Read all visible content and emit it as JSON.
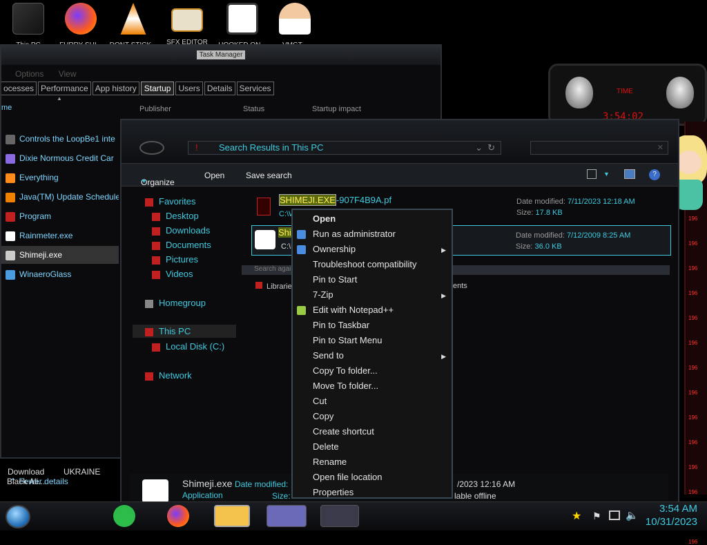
{
  "desktop_icons": [
    {
      "label": "This PC",
      "icon": "pc-icon"
    },
    {
      "label": "FURRY SHI...",
      "icon": "firefox-icon"
    },
    {
      "label": "DONT STICK...",
      "icon": "vlc-icon"
    },
    {
      "label": "SFX EDITOR",
      "icon": "hxd-icon"
    },
    {
      "label": "HOOKED ON...",
      "icon": "app-icon"
    },
    {
      "label": "VMGT...",
      "icon": "doctor-icon"
    }
  ],
  "task_manager": {
    "title": "Task Manager",
    "menu": [
      "Options",
      "View"
    ],
    "tabs": [
      "ocesses",
      "Performance",
      "App history",
      "Startup",
      "Users",
      "Details",
      "Services"
    ],
    "active_tab": "Startup",
    "columns": [
      "me",
      "Publisher",
      "Status",
      "Startup impact"
    ],
    "rows": [
      "Controls the LoopBe1 inte",
      "Dixie Normous Credit Car",
      "Everything",
      "Java(TM) Update Schedule",
      "Program",
      "Rainmeter.exe",
      "Shimeji.exe",
      "WinaeroGlass"
    ],
    "selected_row": "Shimeji.exe",
    "fewer_details": "Fewer details"
  },
  "desktop_bottom": {
    "item1_line1": "Download",
    "item1_line2": "Black Ali...",
    "item2": "UKRAINE"
  },
  "explorer": {
    "address": "Search Results in This PC",
    "toolbar": {
      "organize": "Organize",
      "open": "Open",
      "save_search": "Save search"
    },
    "nav": {
      "favorites": "Favorites",
      "desktop": "Desktop",
      "downloads": "Downloads",
      "documents": "Documents",
      "pictures": "Pictures",
      "videos": "Videos",
      "homegroup": "Homegroup",
      "this_pc": "This PC",
      "local_disk": "Local Disk (C:)",
      "network": "Network"
    },
    "files": [
      {
        "name_highlight": "SHIMEJI.EXE",
        "name_rest": "-907F4B9A.pf",
        "path": "C:\\W",
        "date_label": "Date modified:",
        "date": "7/11/2023 12:18 AM",
        "size_label": "Size:",
        "size": "17.8 KB"
      },
      {
        "name_highlight": "Shi",
        "name_rest": "",
        "path": "C:\\P",
        "date_label": "Date modified:",
        "date": "7/12/2009 8:25 AM",
        "size_label": "Size:",
        "size": "36.0 KB"
      }
    ],
    "search_again": "Search again in:",
    "libraries": "Librarie",
    "contents": "ents",
    "status": {
      "name": "Shimeji.exe",
      "type": "Application",
      "date_label": "Date modified:",
      "date": "/2023 12:16 AM",
      "size_label": "Size:",
      "availability": "lable offline"
    }
  },
  "context_menu": [
    {
      "label": "Open",
      "bold": true
    },
    {
      "label": "Run as administrator",
      "icon": "shield-icon"
    },
    {
      "label": "Ownership",
      "submenu": true,
      "icon": "ownership-icon"
    },
    {
      "label": "Troubleshoot compatibility"
    },
    {
      "label": "Pin to Start"
    },
    {
      "label": "7-Zip",
      "submenu": true
    },
    {
      "label": "Edit with Notepad++",
      "icon": "notepad-icon"
    },
    {
      "label": "Pin to Taskbar"
    },
    {
      "label": "Pin to Start Menu"
    },
    {
      "label": "Send to",
      "submenu": true
    },
    {
      "label": "Copy To folder..."
    },
    {
      "label": "Move To folder..."
    },
    {
      "label": "Cut"
    },
    {
      "label": "Copy"
    },
    {
      "label": "Create shortcut"
    },
    {
      "label": "Delete"
    },
    {
      "label": "Rename"
    },
    {
      "label": "Open file location"
    },
    {
      "label": "Properties"
    }
  ],
  "widget": {
    "label": "TIME",
    "time": "3:54:02"
  },
  "red_side_text": [
    "196",
    "196",
    "196",
    "196",
    "196",
    "196",
    "196",
    "196",
    "196",
    "196",
    "196",
    "196",
    "196",
    "196"
  ],
  "taskbar": {
    "time": "3:54 AM",
    "date": "10/31/2023"
  },
  "colors": {
    "accent": "#3ecbe0",
    "red": "#e01010"
  }
}
